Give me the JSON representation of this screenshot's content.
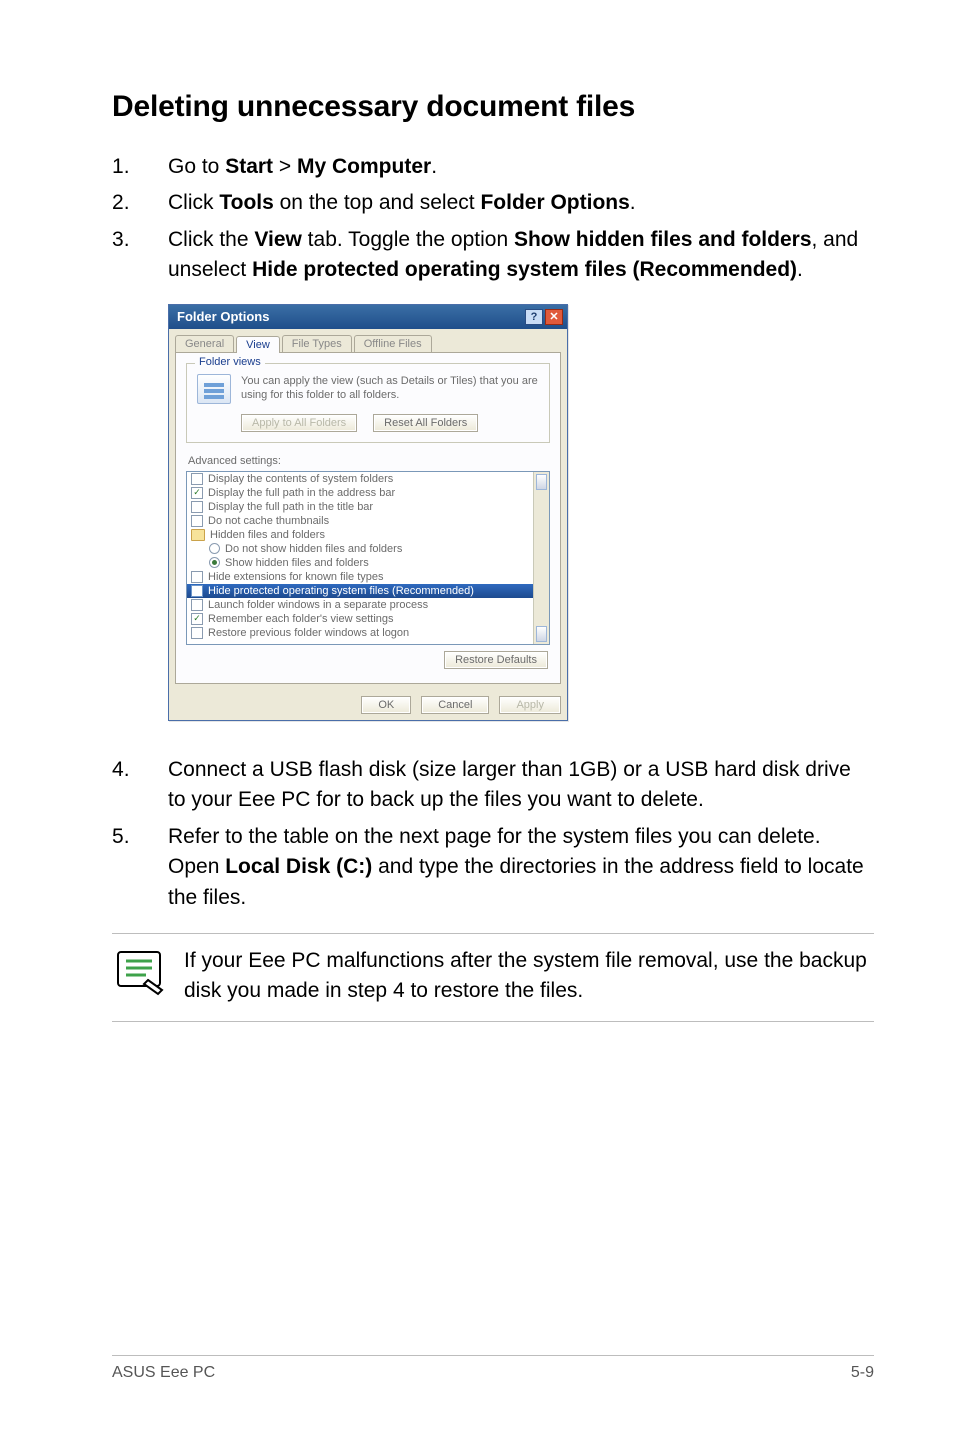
{
  "heading": "Deleting unnecessary document files",
  "steps": {
    "s1": {
      "pre": "Go to ",
      "b1": "Start",
      "mid": " > ",
      "b2": "My Computer",
      "post": "."
    },
    "s2": {
      "pre": "Click ",
      "b1": "Tools",
      "mid": " on the top and select ",
      "b2": "Folder Options",
      "post": "."
    },
    "s3": {
      "pre": "Click the ",
      "b1": "View",
      "mid1": " tab. Toggle the option ",
      "b2": "Show hidden files and folders",
      "mid2": ", and unselect ",
      "b3": "Hide protected operating system files (Recommended)",
      "post": "."
    },
    "s4": "Connect a USB flash disk (size larger than 1GB) or a USB hard disk drive to your Eee PC for to back up the files you want to delete.",
    "s5": {
      "pre": "Refer to the table on the next page for the system files you can delete. Open ",
      "b1": "Local Disk (C:)",
      "post": " and type the directories in the address field to locate the files."
    }
  },
  "dialog": {
    "title": "Folder Options",
    "tabs": {
      "t1": "General",
      "t2": "View",
      "t3": "File Types",
      "t4": "Offline Files"
    },
    "group_legend": "Folder views",
    "group_desc": "You can apply the view (such as Details or Tiles) that you are using for this folder to all folders.",
    "btn_apply_all": "Apply to All Folders",
    "btn_reset_all": "Reset All Folders",
    "adv_label": "Advanced settings:",
    "rows": {
      "r1": "Display the contents of system folders",
      "r2": "Display the full path in the address bar",
      "r3": "Display the full path in the title bar",
      "r4": "Do not cache thumbnails",
      "r5": "Hidden files and folders",
      "r6": "Do not show hidden files and folders",
      "r7": "Show hidden files and folders",
      "r8": "Hide extensions for known file types",
      "r9": "Hide protected operating system files (Recommended)",
      "r10": "Launch folder windows in a separate process",
      "r11": "Remember each folder's view settings",
      "r12": "Restore previous folder windows at logon"
    },
    "btn_restore": "Restore Defaults",
    "btn_ok": "OK",
    "btn_cancel": "Cancel",
    "btn_apply": "Apply"
  },
  "note": "If your Eee PC malfunctions after the system file removal, use the backup disk you made in step 4 to restore the files.",
  "footer": {
    "left": "ASUS Eee PC",
    "right": "5-9"
  }
}
